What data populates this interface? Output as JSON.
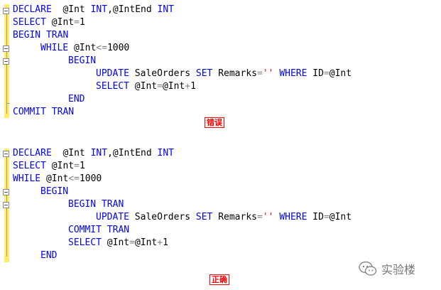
{
  "panel_wrong": {
    "lines": [
      {
        "indent": 0,
        "tokens": [
          {
            "t": "DECLARE",
            "c": "kw"
          },
          {
            "t": "  @Int ",
            "c": ""
          },
          {
            "t": "INT",
            "c": "kw"
          },
          {
            "t": ",@IntEnd ",
            "c": ""
          },
          {
            "t": "INT",
            "c": "kw"
          }
        ]
      },
      {
        "indent": 0,
        "tokens": [
          {
            "t": "SELECT",
            "c": "kw"
          },
          {
            "t": " @Int",
            "c": ""
          },
          {
            "t": "=",
            "c": "op"
          },
          {
            "t": "1",
            "c": ""
          }
        ]
      },
      {
        "indent": 0,
        "tokens": [
          {
            "t": "BEGIN TRAN",
            "c": "kw"
          }
        ]
      },
      {
        "indent": 1,
        "tokens": [
          {
            "t": "WHILE",
            "c": "kw"
          },
          {
            "t": " @Int",
            "c": ""
          },
          {
            "t": "<=",
            "c": "op"
          },
          {
            "t": "1000",
            "c": ""
          }
        ]
      },
      {
        "indent": 2,
        "tokens": [
          {
            "t": "BEGIN",
            "c": "kw"
          }
        ]
      },
      {
        "indent": 3,
        "tokens": [
          {
            "t": "UPDATE",
            "c": "kw"
          },
          {
            "t": " SaleOrders ",
            "c": ""
          },
          {
            "t": "SET",
            "c": "kw"
          },
          {
            "t": " Remarks",
            "c": ""
          },
          {
            "t": "=",
            "c": "op"
          },
          {
            "t": "''",
            "c": "str"
          },
          {
            "t": " ",
            "c": ""
          },
          {
            "t": "WHERE",
            "c": "kw"
          },
          {
            "t": " ID",
            "c": ""
          },
          {
            "t": "=",
            "c": "op"
          },
          {
            "t": "@Int",
            "c": ""
          }
        ]
      },
      {
        "indent": 3,
        "tokens": [
          {
            "t": "SELECT",
            "c": "kw"
          },
          {
            "t": " @Int",
            "c": ""
          },
          {
            "t": "=",
            "c": "op"
          },
          {
            "t": "@Int",
            "c": ""
          },
          {
            "t": "+",
            "c": "op"
          },
          {
            "t": "1",
            "c": ""
          }
        ]
      },
      {
        "indent": 2,
        "tokens": [
          {
            "t": "END",
            "c": "kw"
          }
        ]
      },
      {
        "indent": 0,
        "tokens": [
          {
            "t": "COMMIT TRAN",
            "c": "kw"
          }
        ]
      }
    ],
    "label": "错误"
  },
  "panel_right": {
    "lines": [
      {
        "indent": 0,
        "tokens": [
          {
            "t": "DECLARE",
            "c": "kw"
          },
          {
            "t": "  @Int ",
            "c": ""
          },
          {
            "t": "INT",
            "c": "kw"
          },
          {
            "t": ",@IntEnd ",
            "c": ""
          },
          {
            "t": "INT",
            "c": "kw"
          }
        ]
      },
      {
        "indent": 0,
        "tokens": [
          {
            "t": "SELECT",
            "c": "kw"
          },
          {
            "t": " @Int",
            "c": ""
          },
          {
            "t": "=",
            "c": "op"
          },
          {
            "t": "1",
            "c": ""
          }
        ]
      },
      {
        "indent": 0,
        "tokens": [
          {
            "t": "WHILE",
            "c": "kw"
          },
          {
            "t": " @Int",
            "c": ""
          },
          {
            "t": "<=",
            "c": "op"
          },
          {
            "t": "1000",
            "c": ""
          }
        ]
      },
      {
        "indent": 1,
        "tokens": [
          {
            "t": "BEGIN",
            "c": "kw"
          }
        ]
      },
      {
        "indent": 2,
        "tokens": [
          {
            "t": "BEGIN TRAN",
            "c": "kw"
          }
        ]
      },
      {
        "indent": 3,
        "tokens": [
          {
            "t": "UPDATE",
            "c": "kw"
          },
          {
            "t": " SaleOrders ",
            "c": ""
          },
          {
            "t": "SET",
            "c": "kw"
          },
          {
            "t": " Remarks",
            "c": ""
          },
          {
            "t": "=",
            "c": "op"
          },
          {
            "t": "''",
            "c": "str"
          },
          {
            "t": " ",
            "c": ""
          },
          {
            "t": "WHERE",
            "c": "kw"
          },
          {
            "t": " ID",
            "c": ""
          },
          {
            "t": "=",
            "c": "op"
          },
          {
            "t": "@Int",
            "c": ""
          }
        ]
      },
      {
        "indent": 2,
        "tokens": [
          {
            "t": "COMMIT TRAN",
            "c": "kw"
          }
        ]
      },
      {
        "indent": 2,
        "tokens": [
          {
            "t": "SELECT",
            "c": "kw"
          },
          {
            "t": " @Int",
            "c": ""
          },
          {
            "t": "=",
            "c": "op"
          },
          {
            "t": "@Int",
            "c": ""
          },
          {
            "t": "+",
            "c": "op"
          },
          {
            "t": "1",
            "c": ""
          }
        ]
      },
      {
        "indent": 1,
        "tokens": [
          {
            "t": "END",
            "c": "kw"
          }
        ]
      }
    ],
    "label": "正确"
  },
  "watermark": {
    "text": "实验楼",
    "icon": "wechat-icon"
  },
  "colors": {
    "keyword": "#0000ff",
    "string": "#ff0000",
    "operator": "#808080",
    "gutter": "#ffee66",
    "label": "#ff0000"
  }
}
